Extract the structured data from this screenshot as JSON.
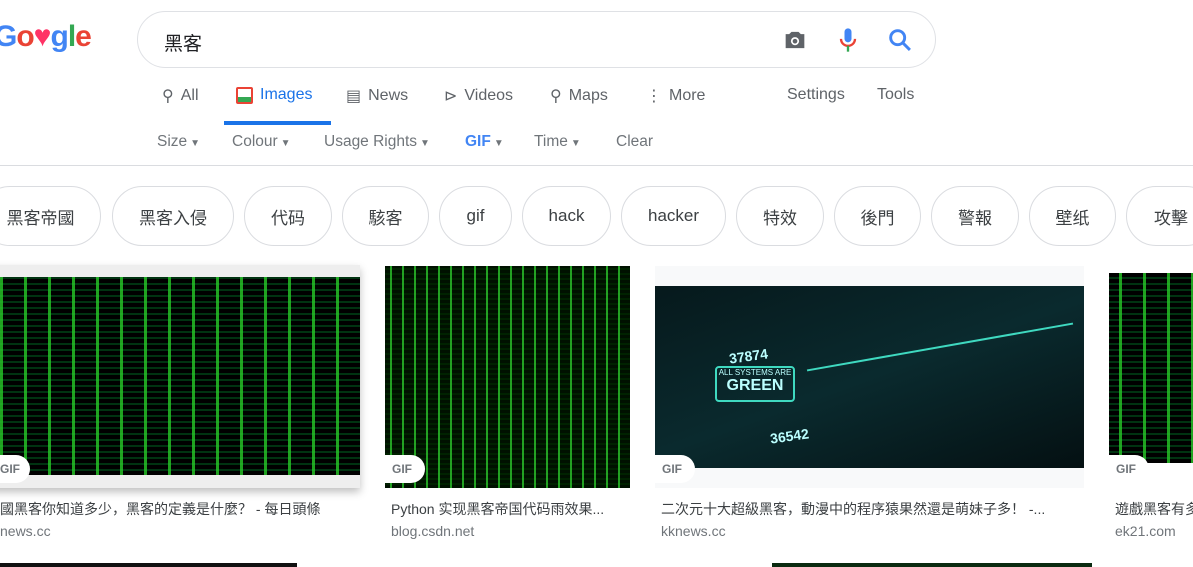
{
  "logo": {
    "text": "Google",
    "colors": [
      "#4285f4",
      "#ea4335",
      "#ff3366",
      "#4285f4",
      "#34a853",
      "#ea4335"
    ]
  },
  "search": {
    "query": "黑客"
  },
  "tabs": [
    {
      "label": "All",
      "icon": "search-icon"
    },
    {
      "label": "Images",
      "icon": "image-icon",
      "active": true
    },
    {
      "label": "News",
      "icon": "news-icon"
    },
    {
      "label": "Videos",
      "icon": "play-icon"
    },
    {
      "label": "Maps",
      "icon": "map-pin-icon"
    },
    {
      "label": "More",
      "icon": "more-vert-icon"
    },
    {
      "label": "Settings"
    },
    {
      "label": "Tools"
    }
  ],
  "filters": [
    {
      "label": "Size"
    },
    {
      "label": "Colour"
    },
    {
      "label": "Usage Rights"
    },
    {
      "label": "GIF",
      "active": true
    },
    {
      "label": "Time"
    },
    {
      "label": "Clear"
    }
  ],
  "chips": [
    "黑客帝國",
    "黑客入侵",
    "代码",
    "駭客",
    "gif",
    "hack",
    "hacker",
    "特效",
    "後門",
    "警報",
    "壁纸",
    "攻擊"
  ],
  "results": [
    {
      "badge": "GIF",
      "title": "國黑客你知道多少，黑客的定義是什麼？ - 每日頭條",
      "source": "news.cc"
    },
    {
      "badge": "GIF",
      "title": "Python 实现黑客帝国代码雨效果...",
      "source": "blog.csdn.net"
    },
    {
      "badge": "GIF",
      "title": "二次元十大超級黑客，動漫中的程序猿果然還是萌妹子多！ -...",
      "source": "kknews.cc",
      "overlay": [
        "ALL SYSTEMS ARE",
        "GREEN",
        "37874",
        "36542"
      ]
    },
    {
      "badge": "GIF",
      "title": "遊戲黑客有多",
      "source": "ek21.com"
    }
  ],
  "accent": "#1a73e8"
}
